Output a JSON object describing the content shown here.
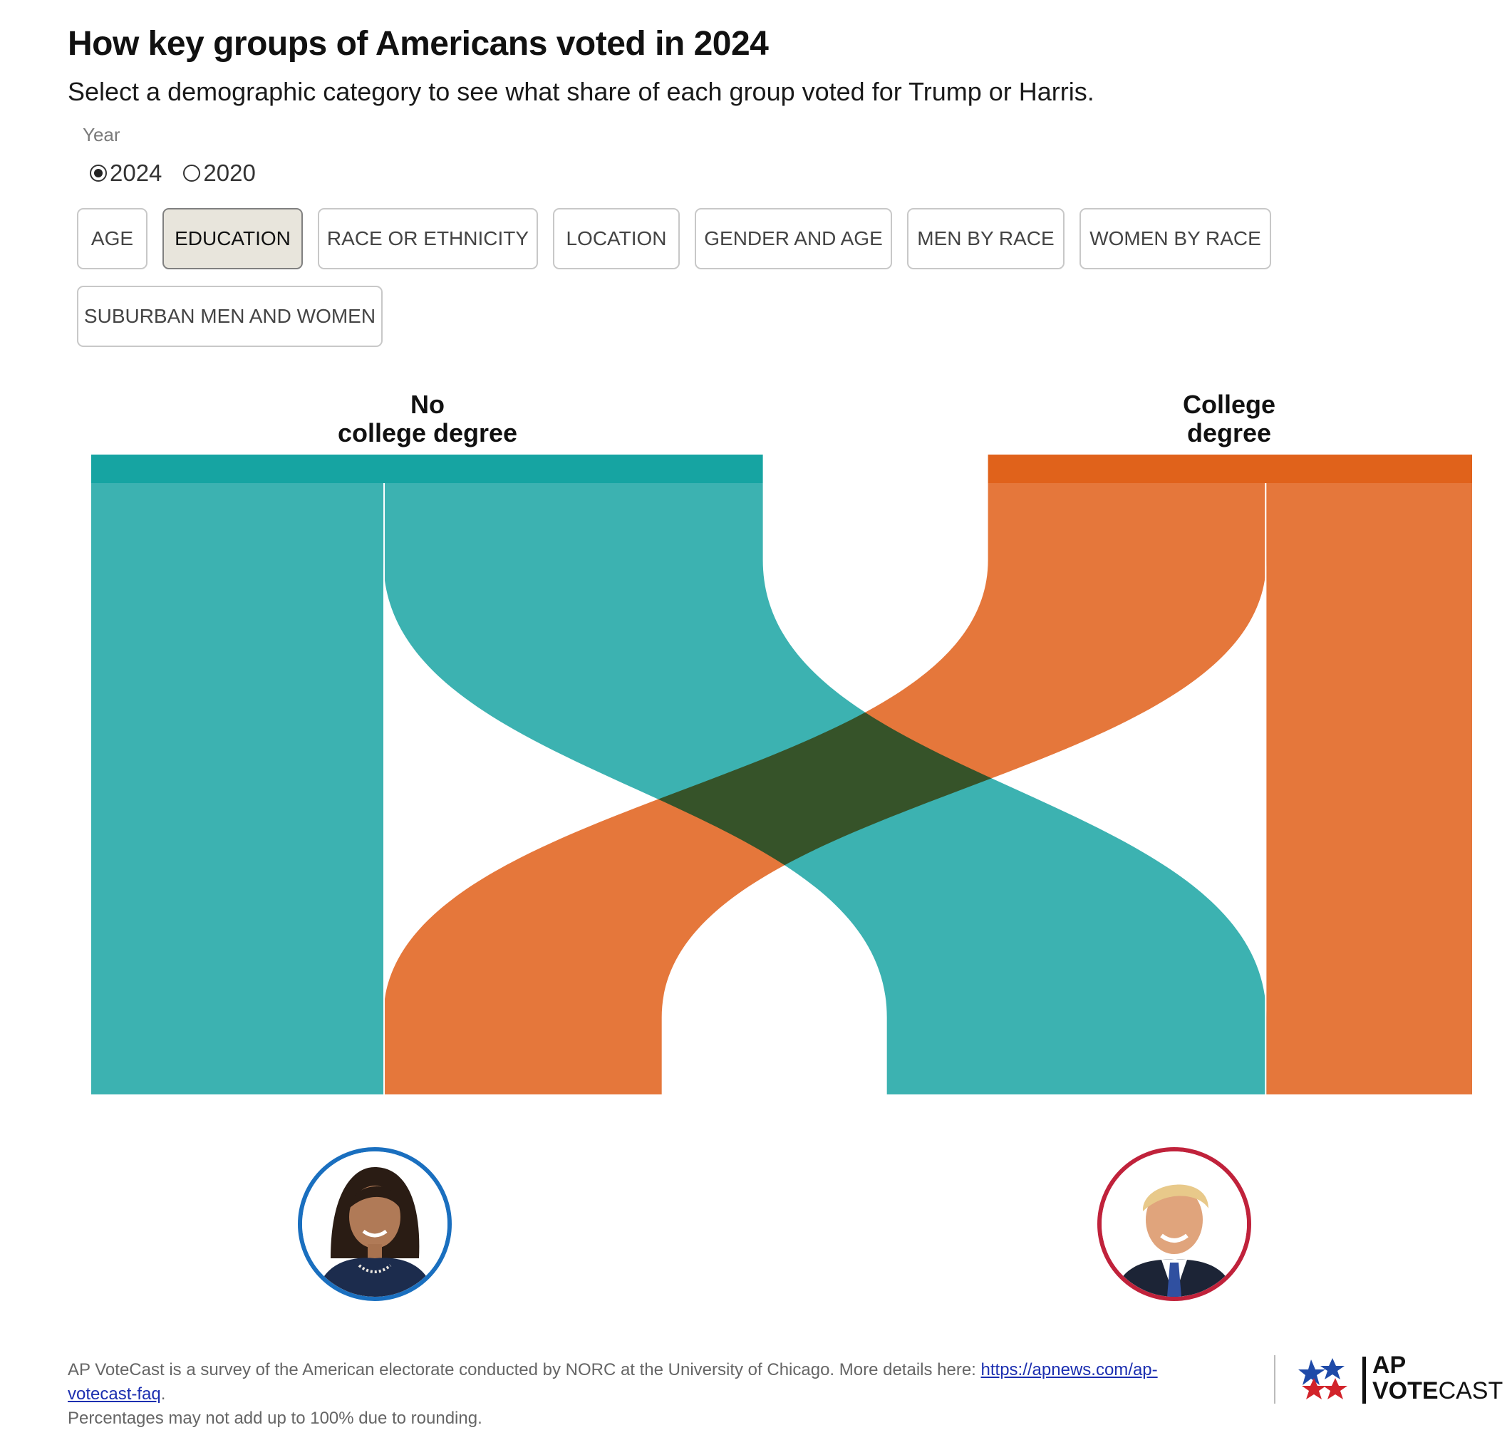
{
  "header": {
    "title": "How key groups of Americans voted in 2024",
    "subtitle": "Select a demographic category to see what share of each group voted for Trump or Harris."
  },
  "year_selector": {
    "label": "Year",
    "options": [
      {
        "label": "2024",
        "selected": true
      },
      {
        "label": "2020",
        "selected": false
      }
    ]
  },
  "categories": [
    {
      "label": "AGE",
      "active": false
    },
    {
      "label": "EDUCATION",
      "active": true
    },
    {
      "label": "RACE OR ETHNICITY",
      "active": false
    },
    {
      "label": "LOCATION",
      "active": false
    },
    {
      "label": "GENDER AND AGE",
      "active": false
    },
    {
      "label": "MEN BY RACE",
      "active": false
    },
    {
      "label": "WOMEN BY RACE",
      "active": false
    },
    {
      "label": "SUBURBAN MEN AND WOMEN",
      "active": false
    }
  ],
  "chart_data": {
    "type": "sankey",
    "groups": [
      {
        "name": "No\ncollege degree",
        "color": "#16a4a2",
        "share": 0.487
      },
      {
        "name": "College\ndegree",
        "color": "#e0621b",
        "share": 0.351
      }
    ],
    "candidates": [
      {
        "name": "Harris",
        "ring_color": "#1a6fbf"
      },
      {
        "name": "Trump",
        "ring_color": "#c0223b"
      }
    ],
    "flows": [
      {
        "group": "No\ncollege degree",
        "candidate": "Trump",
        "value": 0.565
      },
      {
        "group": "No\ncollege degree",
        "candidate": "Harris",
        "value": 0.435
      },
      {
        "group": "College\ndegree",
        "candidate": "Trump",
        "value": 0.425
      },
      {
        "group": "College\ndegree",
        "candidate": "Harris",
        "value": 0.575
      }
    ],
    "colors": {
      "teal_flow": "#3cb2b1",
      "orange_flow": "#e5773b",
      "overlap": "#34532a"
    }
  },
  "footer": {
    "note": "AP VoteCast is a survey of the American electorate conducted by NORC at the University of Chicago. More details here: ",
    "link": "https://apnews.com/ap-votecast-faq",
    "after_link": ".",
    "note2": "Percentages may not add up to 100% due to rounding.",
    "logo_top": "AP",
    "logo_bottom_bold": "VOTE",
    "logo_bottom_light": "CAST"
  }
}
